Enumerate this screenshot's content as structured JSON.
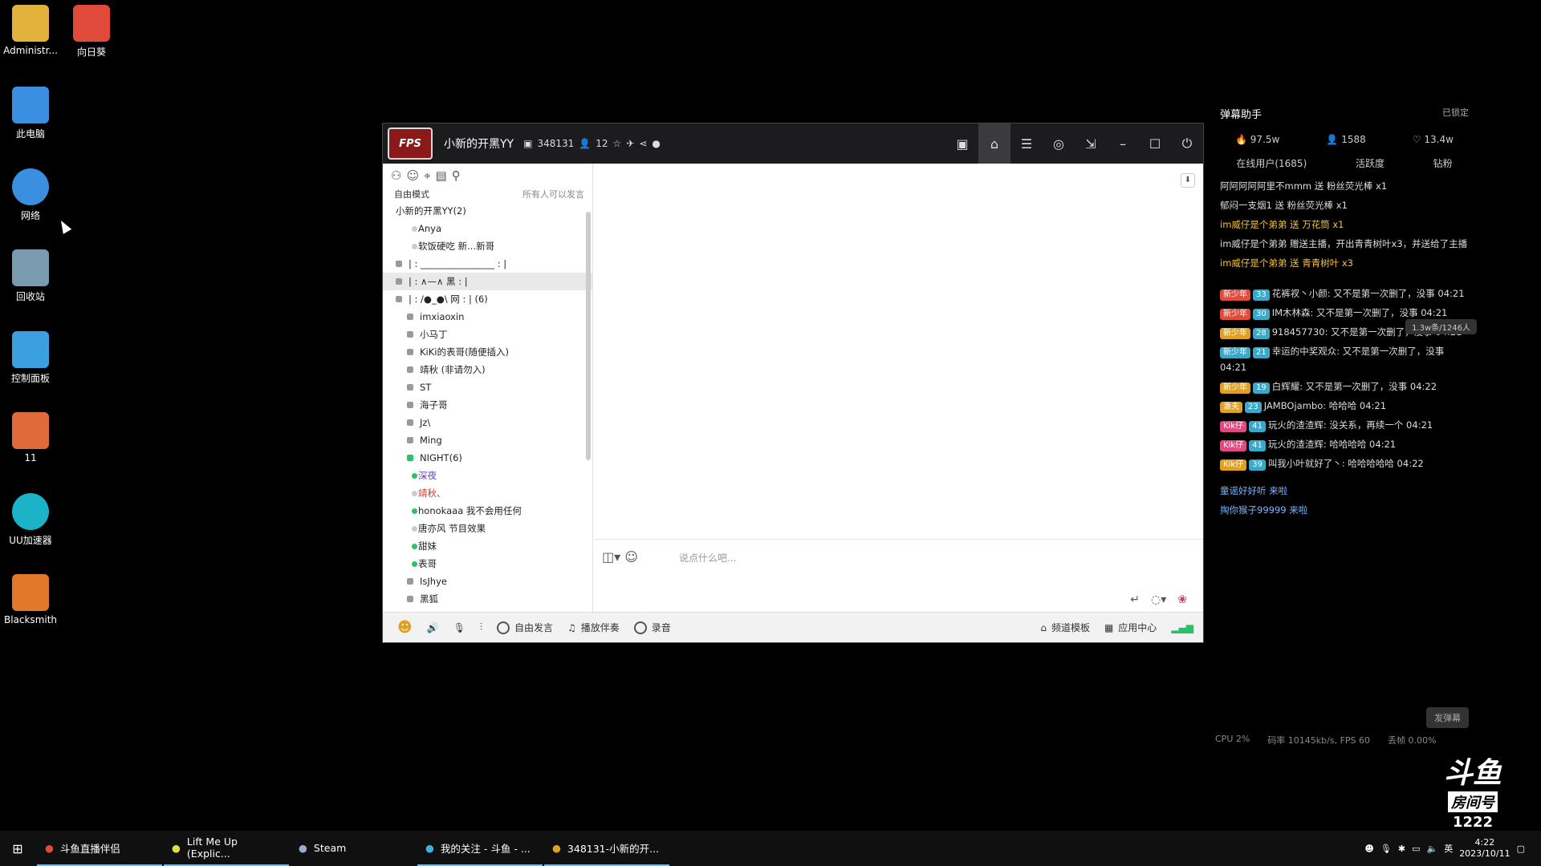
{
  "desktop": {
    "icons": [
      {
        "label": "Administr...",
        "color": "#e3b23c"
      },
      {
        "label": "向日葵",
        "color": "#e04a3a"
      },
      {
        "label": "此电脑",
        "color": "#3a8fe0"
      },
      {
        "label": "网络",
        "color": "#3a8fe0"
      },
      {
        "label": "回收站",
        "color": "#7a9ab0"
      },
      {
        "label": "控制面板",
        "color": "#3aa0e0"
      },
      {
        "label": "11",
        "color": "#e06a3a"
      },
      {
        "label": "UU加速器",
        "color": "#1ab3c8"
      },
      {
        "label": "Blacksmith",
        "color": "#e07a2a"
      }
    ]
  },
  "yy": {
    "title": "小新的开黑YY",
    "channel_id": "348131",
    "user_count": "12",
    "mode": "自由模式",
    "mode_note": "所有人可以发言",
    "channels": [
      {
        "text": "小新的开黑YY(2)"
      },
      {
        "text": "| :  ________________  : |"
      },
      {
        "text": "| :      ∧—∧     黑     : |"
      },
      {
        "text": "| :     /●_●\\    网     : | (6)"
      }
    ],
    "top_users": [
      "Anya",
      "软饭硬吃  新...新哥"
    ],
    "users": [
      "imxiaoxin",
      "小马丁",
      "KiKi的表哥(随便插入)",
      "靖秋 (非请勿入)",
      "ST",
      "海子哥",
      "Jz\\",
      "Ming",
      "NIGHT(6)",
      "深夜",
      "靖秋、",
      "honokaaa  我不会用任何",
      "唐亦风  节目效果",
      "甜妹",
      "表哥",
      "IsJhye",
      "黑狐"
    ],
    "input_placeholder": "说点什么吧...",
    "bottom": [
      "自由发言",
      "播放伴奏",
      "录音",
      "频道模板",
      "应用中心"
    ]
  },
  "panel": {
    "title": "弹幕助手",
    "lock": "已锁定",
    "stats": [
      "97.5w",
      "1588",
      "13.4w"
    ],
    "tabs": [
      "在线用户(1685)",
      "活跃度",
      "钻粉"
    ],
    "viewers": "1.3w条/1246人",
    "messages": [
      "阿阿阿阿阿里不mmm 送 粉丝荧光棒 x1",
      "郁闷一支烟1 送 粉丝荧光棒 x1",
      "im威仔是个弟弟 送 万花筒 x1",
      "im威仔是个弟弟 赠送主播，开出青青树叶x3，并送给了主播",
      "im威仔是个弟弟 送 青青树叶 x3",
      "花裤衩丶小颜: 又不是第一次删了，没事 04:21",
      "IM木林森: 又不是第一次删了，没事 04:21",
      "918457730: 又不是第一次删了，没事 04:21",
      "幸运的中奖观众: 又不是第一次删了，没事 04:21",
      "白辉耀: 又不是第一次删了，没事 04:22",
      "JAMBOjambo: 哈哈哈 04:21",
      "玩火的渣渣辉: 没关系，再续一个 04:21",
      "玩火的渣渣辉: 哈哈哈哈 04:21",
      "叫我小叶就好了丶: 哈哈哈哈哈 04:22",
      "童谣好好听 来啦",
      "掏你猴子99999 来啦"
    ],
    "send": "发弹幕",
    "cpu": "CPU 2%",
    "rate": "码率 10145kb/s, FPS 60",
    "loss": "丢帧 0.00%"
  },
  "douyu": {
    "brand": "斗鱼",
    "label": "房间号",
    "room": "1222"
  },
  "taskbar": {
    "items": [
      "斗鱼直播伴侣",
      "Lift Me Up (Explic...",
      "Steam",
      "我的关注 - 斗鱼 - ...",
      "348131-小新的开..."
    ],
    "lang": "英",
    "time": "4:22",
    "date": "2023/10/11"
  }
}
